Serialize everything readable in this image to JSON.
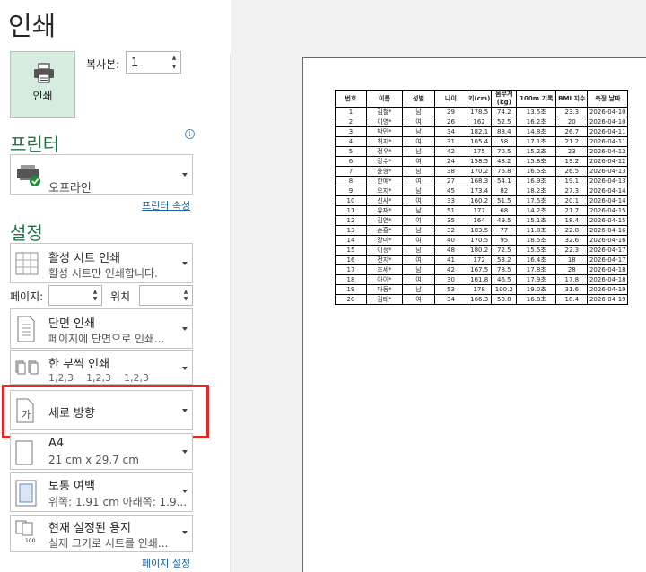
{
  "title": "인쇄",
  "print_button": {
    "label": "인쇄",
    "icon": "printer-icon"
  },
  "copies": {
    "label": "복사본:",
    "value": "1"
  },
  "printer": {
    "section_title": "프린터",
    "name": "오프라인",
    "status_icon": "check-icon",
    "properties_link": "프린터 속성"
  },
  "settings": {
    "section_title": "설정",
    "scope": {
      "title": "활성 시트 인쇄",
      "subtitle": "활성 시트만 인쇄합니다."
    },
    "pages": {
      "label": "페이지:",
      "to_label": "위치",
      "from_value": "",
      "to_value": ""
    },
    "sides": {
      "title": "단면 인쇄",
      "subtitle": "페이지에 단면으로 인쇄..."
    },
    "collate": {
      "title": "한 부씩 인쇄",
      "subtitle": "1,2,3    1,2,3    1,2,3"
    },
    "orientation": {
      "title": "세로 방향",
      "icon_char": "가"
    },
    "paper": {
      "title": "A4",
      "subtitle": "21 cm x 29.7 cm"
    },
    "margins": {
      "title": "보통 여백",
      "subtitle": "위쪽: 1.91 cm 아래쪽: 1.9..."
    },
    "scaling": {
      "title": "현재 설정된 용지",
      "subtitle": "실제 크기로 시트를 인쇄...",
      "icon_text": "100"
    },
    "page_setup_link": "페이지 설정"
  },
  "highlight_color": "#e02a2a",
  "accent_color": "#217346",
  "preview_table": {
    "headers": [
      "번호",
      "이름",
      "성별",
      "나이",
      "키(cm)",
      "몸무게\n(kg)",
      "100m 기록",
      "BMI 지수",
      "측정 날짜"
    ],
    "rows": [
      [
        "1",
        "김철*",
        "남",
        "29",
        "178.5",
        "74.2",
        "13.5초",
        "23.3",
        "2026-04-10"
      ],
      [
        "2",
        "이영*",
        "여",
        "26",
        "162",
        "52.5",
        "16.2초",
        "20",
        "2026-04-10"
      ],
      [
        "3",
        "박민*",
        "남",
        "34",
        "182.1",
        "88.4",
        "14.8초",
        "26.7",
        "2026-04-11"
      ],
      [
        "4",
        "최지*",
        "여",
        "31",
        "165.4",
        "58",
        "17.1초",
        "21.2",
        "2026-04-11"
      ],
      [
        "5",
        "정우*",
        "남",
        "42",
        "175",
        "70.5",
        "15.2초",
        "23",
        "2026-04-12"
      ],
      [
        "6",
        "강수*",
        "여",
        "24",
        "158.5",
        "48.2",
        "15.8초",
        "19.2",
        "2026-04-12"
      ],
      [
        "7",
        "윤형*",
        "남",
        "38",
        "170.2",
        "76.8",
        "16.5초",
        "26.5",
        "2026-04-13"
      ],
      [
        "8",
        "한예*",
        "여",
        "27",
        "168.3",
        "54.1",
        "16.9초",
        "19.1",
        "2026-04-13"
      ],
      [
        "9",
        "오지*",
        "남",
        "45",
        "173.4",
        "82",
        "18.2초",
        "27.3",
        "2026-04-14"
      ],
      [
        "10",
        "신사*",
        "여",
        "33",
        "160.2",
        "51.5",
        "17.5초",
        "20.1",
        "2026-04-14"
      ],
      [
        "11",
        "유재*",
        "남",
        "51",
        "177",
        "68",
        "14.2초",
        "21.7",
        "2026-04-15"
      ],
      [
        "12",
        "김연*",
        "여",
        "35",
        "164",
        "49.5",
        "15.1초",
        "18.4",
        "2026-04-15"
      ],
      [
        "13",
        "손흥*",
        "남",
        "32",
        "183.5",
        "77",
        "11.8초",
        "22.8",
        "2026-04-16"
      ],
      [
        "14",
        "장미*",
        "여",
        "40",
        "170.5",
        "95",
        "18.5초",
        "32.6",
        "2026-04-16"
      ],
      [
        "15",
        "이정*",
        "남",
        "48",
        "180.2",
        "72.5",
        "15.5초",
        "22.3",
        "2026-04-17"
      ],
      [
        "16",
        "전지*",
        "여",
        "41",
        "172",
        "53.2",
        "16.4초",
        "18",
        "2026-04-17"
      ],
      [
        "17",
        "조세*",
        "남",
        "42",
        "167.5",
        "78.5",
        "17.8초",
        "28",
        "2026-04-18"
      ],
      [
        "18",
        "아이*",
        "여",
        "30",
        "161.8",
        "46.5",
        "17.9초",
        "17.8",
        "2026-04-18"
      ],
      [
        "19",
        "마동*",
        "남",
        "53",
        "178",
        "100.2",
        "19.0초",
        "31.6",
        "2026-04-19"
      ],
      [
        "20",
        "김태*",
        "여",
        "34",
        "166.3",
        "50.8",
        "16.8초",
        "18.4",
        "2026-04-19"
      ]
    ]
  }
}
